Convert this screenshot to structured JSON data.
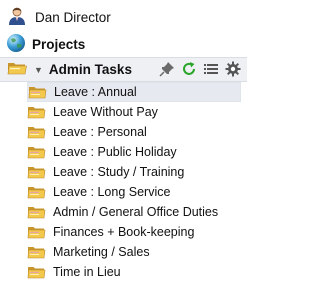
{
  "user": {
    "name": "Dan Director",
    "icon": "user-avatar-icon"
  },
  "projects": {
    "label": "Projects",
    "icon": "globe-icon"
  },
  "category": {
    "label": "Admin Tasks",
    "expanded": true,
    "tools": [
      "pin-icon",
      "refresh-icon",
      "list-icon",
      "gear-icon"
    ]
  },
  "tasks": [
    {
      "label": "Leave : Annual",
      "selected": true
    },
    {
      "label": "Leave Without Pay"
    },
    {
      "label": "Leave : Personal"
    },
    {
      "label": "Leave : Public Holiday"
    },
    {
      "label": "Leave : Study / Training"
    },
    {
      "label": "Leave : Long Service"
    },
    {
      "label": "Admin / General Office Duties"
    },
    {
      "label": "Finances + Book-keeping"
    },
    {
      "label": "Marketing / Sales"
    },
    {
      "label": "Time in Lieu"
    }
  ],
  "colors": {
    "folder": "#f2c94c",
    "folder_dark": "#c9962b",
    "folder_pink": "#e8a0b0",
    "refresh": "#2aa52a"
  }
}
